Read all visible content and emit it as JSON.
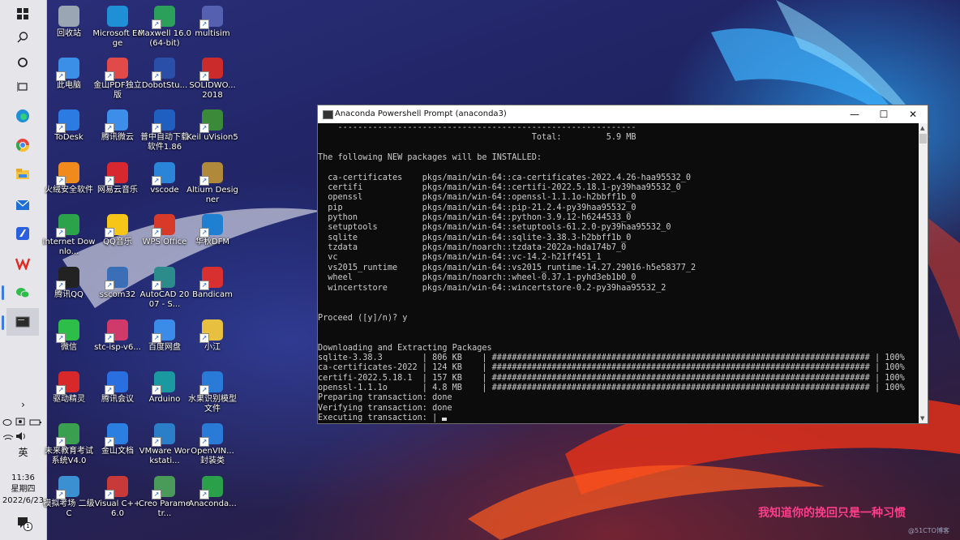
{
  "taskbar": {
    "clock_time": "11:36",
    "clock_weekday": "星期四",
    "clock_date": "2022/6/23",
    "ime": "英",
    "notification_count": "1"
  },
  "desktop_icons": [
    {
      "label": "回收站",
      "color": "#9aa6b4"
    },
    {
      "label": "Microsoft Edge",
      "color": "#1f8fd6"
    },
    {
      "label": "Maxwell 16.0 (64-bit)",
      "color": "#2aa05a"
    },
    {
      "label": "multisim",
      "color": "#5560b0"
    },
    {
      "label": "此电脑",
      "color": "#3b8fe6"
    },
    {
      "label": "金山PDF独立版",
      "color": "#e24a4a"
    },
    {
      "label": "DobotStu...",
      "color": "#2a4fa8"
    },
    {
      "label": "SOLIDWO... 2018",
      "color": "#cc2b2b"
    },
    {
      "label": "ToDesk",
      "color": "#2b7be3"
    },
    {
      "label": "腾讯微云",
      "color": "#3c8ee8"
    },
    {
      "label": "普中自动下载软件1.86",
      "color": "#1e5fbf"
    },
    {
      "label": "Keil uVision5",
      "color": "#3a8a3a"
    },
    {
      "label": "火绒安全软件",
      "color": "#f08a1c"
    },
    {
      "label": "网易云音乐",
      "color": "#d7282f"
    },
    {
      "label": "vscode",
      "color": "#2a84d8"
    },
    {
      "label": "Altium Designer",
      "color": "#b08a3a"
    },
    {
      "label": "Internet Downlo...",
      "color": "#2aa34a"
    },
    {
      "label": "QQ音乐",
      "color": "#f5c518"
    },
    {
      "label": "WPS Office",
      "color": "#d83a2a"
    },
    {
      "label": "华秋DFM",
      "color": "#1f7fd0"
    },
    {
      "label": "腾讯QQ",
      "color": "#222222"
    },
    {
      "label": "sscom32",
      "color": "#3a6fb8"
    },
    {
      "label": "AutoCAD 2007 - S...",
      "color": "#2c8c8c"
    },
    {
      "label": "Bandicam",
      "color": "#d83030"
    },
    {
      "label": "微信",
      "color": "#2dbe4a"
    },
    {
      "label": "stc-isp-v6...",
      "color": "#d03a6a"
    },
    {
      "label": "百度网盘",
      "color": "#3a8ce8"
    },
    {
      "label": "小江",
      "color": "#e8c040"
    },
    {
      "label": "驱动精灵",
      "color": "#d8282a"
    },
    {
      "label": "腾讯会议",
      "color": "#2a6fe0"
    },
    {
      "label": "Arduino",
      "color": "#1a9aa0"
    },
    {
      "label": "水果识别模型文件",
      "color": "#2a7ad8"
    },
    {
      "label": "未来教育考试系统V4.0",
      "color": "#3aa050"
    },
    {
      "label": "金山文档",
      "color": "#2a7fe0"
    },
    {
      "label": "VMware Workstati...",
      "color": "#2a7fc8"
    },
    {
      "label": "OpenVIN... 封装类",
      "color": "#2a7ad8"
    },
    {
      "label": "模拟考场 二级C",
      "color": "#3a90d0"
    },
    {
      "label": "Visual C++ 6.0",
      "color": "#c83a3a"
    },
    {
      "label": "Creo Parametr...",
      "color": "#4a9a5a"
    },
    {
      "label": "Anaconda...",
      "color": "#2aa04a"
    }
  ],
  "terminal": {
    "title": "Anaconda Powershell Prompt (anaconda3)",
    "minimize": "—",
    "maximize": "☐",
    "close": "✕",
    "lines": [
      "    ------------------------------------------------------------",
      "                                           Total:         5.9 MB",
      "",
      "The following NEW packages will be INSTALLED:",
      "",
      "  ca-certificates    pkgs/main/win-64::ca-certificates-2022.4.26-haa95532_0",
      "  certifi            pkgs/main/win-64::certifi-2022.5.18.1-py39haa95532_0",
      "  openssl            pkgs/main/win-64::openssl-1.1.1o-h2bbff1b_0",
      "  pip                pkgs/main/win-64::pip-21.2.4-py39haa95532_0",
      "  python             pkgs/main/win-64::python-3.9.12-h6244533_0",
      "  setuptools         pkgs/main/win-64::setuptools-61.2.0-py39haa95532_0",
      "  sqlite             pkgs/main/win-64::sqlite-3.38.3-h2bbff1b_0",
      "  tzdata             pkgs/main/noarch::tzdata-2022a-hda174b7_0",
      "  vc                 pkgs/main/win-64::vc-14.2-h21ff451_1",
      "  vs2015_runtime     pkgs/main/win-64::vs2015_runtime-14.27.29016-h5e58377_2",
      "  wheel              pkgs/main/noarch::wheel-0.37.1-pyhd3eb1b0_0",
      "  wincertstore       pkgs/main/win-64::wincertstore-0.2-py39haa95532_2",
      "",
      "",
      "Proceed ([y]/n)? y",
      "",
      "",
      "Downloading and Extracting Packages",
      "sqlite-3.38.3        | 806 KB    | ############################################################################ | 100%",
      "ca-certificates-2022 | 124 KB    | ############################################################################ | 100%",
      "certifi-2022.5.18.1  | 157 KB    | ############################################################################ | 100%",
      "openssl-1.1.1o       | 4.8 MB    | ############################################################################ | 100%",
      "Preparing transaction: done",
      "Verifying transaction: done",
      "Executing transaction: | "
    ]
  },
  "watermark": "我知道你的挽回只是一种习惯",
  "credit": "@51CTO博客"
}
